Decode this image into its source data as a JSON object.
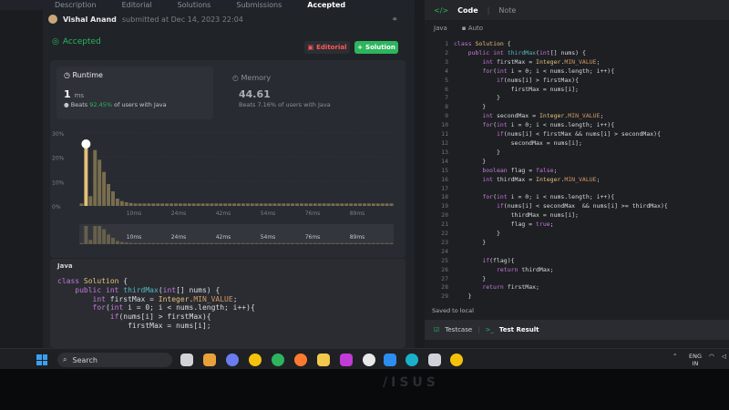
{
  "top_tabs": [
    "Description",
    "Editorial",
    "Solutions",
    "Submissions",
    "Accepted"
  ],
  "submission": {
    "user_name": "Vishal Anand",
    "submitted_text": "submitted at Dec 14, 2023 22:04",
    "status": "Accepted",
    "editorial_label": "Editorial",
    "solution_label": "Solution"
  },
  "runtime": {
    "title": "Runtime",
    "value": "1",
    "unit": "ms",
    "beats_prefix": "Beats",
    "beats_pct": "92.45%",
    "beats_suffix": "of users with Java"
  },
  "memory": {
    "title": "Memory",
    "value": "44.61",
    "beats_text": "Beats 7.16% of users with Java"
  },
  "chart_data": {
    "type": "bar",
    "yticks": [
      "30%",
      "20%",
      "10%",
      "0%"
    ],
    "xticks": [
      "10ms",
      "24ms",
      "42ms",
      "54ms",
      "76ms",
      "89ms"
    ],
    "ylim": [
      0,
      30
    ],
    "values": [
      1,
      24,
      4,
      23,
      19,
      14,
      9,
      6,
      3,
      2,
      1.5,
      1.2,
      1,
      1,
      1,
      1,
      1,
      1,
      1,
      1,
      1,
      1,
      1,
      1,
      1,
      1,
      1,
      1,
      1,
      1,
      1,
      1,
      1,
      1,
      1,
      1,
      1,
      1,
      1,
      1,
      1,
      1,
      1,
      1,
      1,
      1,
      1,
      1,
      1,
      1,
      1,
      1,
      1,
      1,
      1,
      1,
      1,
      1,
      1,
      1,
      1,
      1,
      1,
      1,
      1,
      1,
      1,
      1,
      1,
      1
    ],
    "highlight_index": 1,
    "bar_color": "#9a8a5a",
    "highlight_color": "#e5c07b",
    "minimap_xticks": [
      "10ms",
      "24ms",
      "42ms",
      "54ms",
      "76ms",
      "89ms"
    ]
  },
  "code_preview": {
    "lang": "Java",
    "lines": [
      "class Solution {",
      "    public int thirdMax(int[] nums) {",
      "        int firstMax = Integer.MIN_VALUE;",
      "        for(int i = 0; i < nums.length; i++){",
      "            if(nums[i] > firstMax){",
      "                firstMax = nums[i];"
    ]
  },
  "editor": {
    "tab_code": "Code",
    "tab_note": "Note",
    "lang": "Java",
    "auto": "Auto",
    "line_numbers": [
      "1",
      "2",
      "3",
      "4",
      "5",
      "6",
      "7",
      "8",
      "9",
      "10",
      "11",
      "12",
      "13",
      "14",
      "15",
      "16",
      "17",
      "18",
      "19",
      "20",
      "21",
      "22",
      "23",
      "24",
      "25",
      "26",
      "27",
      "28",
      "29"
    ],
    "lines": [
      "class Solution {",
      "    public int thirdMax(int[] nums) {",
      "        int firstMax = Integer.MIN_VALUE;",
      "        for(int i = 0; i < nums.length; i++){",
      "            if(nums[i] > firstMax){",
      "                firstMax = nums[i];",
      "            }",
      "        }",
      "        int secondMax = Integer.MIN_VALUE;",
      "        for(int i = 0; i < nums.length; i++){",
      "            if(nums[i] < firstMax && nums[i] > secondMax){",
      "                secondMax = nums[i];",
      "            }",
      "        }",
      "        boolean flag = false;",
      "        int thirdMax = Integer.MIN_VALUE;",
      "",
      "        for(int i = 0; i < nums.length; i++){",
      "            if(nums[i] < secondMax  && nums[i] >= thirdMax){",
      "                thirdMax = nums[i];",
      "                flag = true;",
      "            }",
      "        }",
      "",
      "        if(flag){",
      "            return thirdMax;",
      "        }",
      "        return firstMax;",
      "    }"
    ],
    "saved_text": "Saved to local",
    "testcase_label": "Testcase",
    "testresult_label": "Test Result"
  },
  "taskbar": {
    "search_placeholder": "Search",
    "lang_line1": "ENG",
    "lang_line2": "IN"
  },
  "brand_text": "/ISUS"
}
